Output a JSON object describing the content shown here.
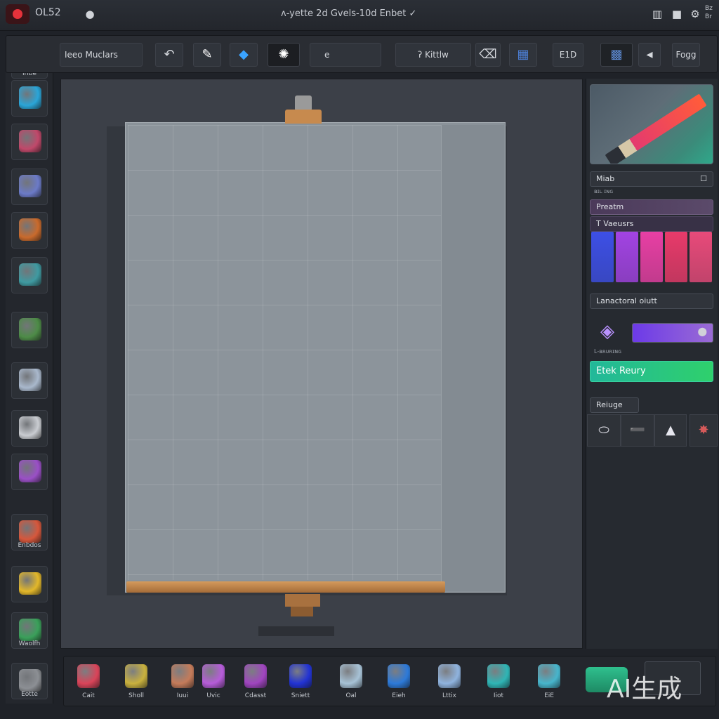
{
  "titlebar": {
    "app_name": "OL52",
    "document_title": "ʌ-yette   2d Gvels-10d Enbet ✓",
    "icons": [
      "record-icon",
      "grid-icon",
      "square-icon",
      "settings-icon"
    ],
    "tray_text": "Bz\nBr"
  },
  "toolbar": {
    "field_label": "Ieeo Muclars",
    "search_label": "e",
    "search2_label": "ʔ   Kittlw",
    "zoom_label": "E1D",
    "right_label": "Fogg",
    "icons": [
      "undo-icon",
      "brush-icon",
      "fill-icon",
      "splatter-icon",
      "eraser-icon",
      "layers-icon",
      "texture-icon",
      "arrow-icon"
    ]
  },
  "leftrail": {
    "items": [
      {
        "label": "Iribe",
        "color": "#2b5fb3",
        "icon": "gem-icon"
      },
      {
        "label": "",
        "color": "#2aa5d8",
        "icon": "bucket-icon"
      },
      {
        "label": "",
        "color": "#c0486a",
        "icon": "marker-icon"
      },
      {
        "label": "",
        "color": "#6b7ac7",
        "icon": "pen-icon"
      },
      {
        "label": "",
        "color": "#c96a2c",
        "icon": "crate-icon"
      },
      {
        "label": "",
        "color": "#3f9aa1",
        "icon": "circuit-icon"
      },
      {
        "label": "",
        "color": "#4d8b47",
        "icon": "mosaic-icon"
      },
      {
        "label": "",
        "color": "#a9b8cc",
        "icon": "chat-icon"
      },
      {
        "label": "",
        "color": "#c9ccd1",
        "icon": "document-icon"
      },
      {
        "label": "",
        "color": "#9a4fc6",
        "icon": "flower-icon"
      },
      {
        "label": "Enbdos",
        "color": "#d6573c",
        "icon": "palette-icon"
      },
      {
        "label": "",
        "color": "#e2b72a",
        "icon": "sphere-icon"
      },
      {
        "label": "Waolfh",
        "color": "#3aa05a",
        "icon": "orb-icon"
      },
      {
        "label": "Eotte",
        "color": "#8c8f94",
        "icon": "brush-set-icon"
      }
    ]
  },
  "rightpanel": {
    "preview_icon": "pencil-icon",
    "rows": {
      "mask": "Miab",
      "mask_sub": "ʙɪʟ ɪɴɢ",
      "preset": "Preatm",
      "variants": "T Vaeusrs",
      "color_mode": "Lanactoral oiutt",
      "gradient_sub": "L-ʙʀᴜʀɪɴɢ",
      "brush_ready": "Etek Reury",
      "reset": "Reiuge"
    },
    "swatches": [
      "#3d4fe6",
      "#a243e3",
      "#e83fa4",
      "#e83a6a",
      "#e84a7a"
    ],
    "gradient_colors": [
      "#6c3ae8",
      "#9a6bd4"
    ],
    "brush_icons": [
      "eraser-icon",
      "stroke-icon",
      "nib-icon",
      "splat-icon"
    ]
  },
  "dock": {
    "items": [
      {
        "label": "Cait",
        "color": "#d94459",
        "icon": "fabric-icon"
      },
      {
        "label": "Sholl",
        "color": "#c9b13e",
        "icon": "shell-icon"
      },
      {
        "label": "Iuui",
        "color": "#c47b5a",
        "icon": "figure-icon"
      },
      {
        "label": "Uvic",
        "color": "#b65cd9",
        "icon": "cube-icon"
      },
      {
        "label": "Cdasst",
        "color": "#a045c0",
        "icon": "box-icon"
      },
      {
        "label": "Sniett",
        "color": "#2233d4",
        "icon": "blob-icon"
      },
      {
        "label": "Oal",
        "color": "#a7c2d6",
        "icon": "house-icon"
      },
      {
        "label": "Eieh",
        "color": "#2d7ad9",
        "icon": "flag-icon"
      },
      {
        "label": "Lttix",
        "color": "#8fb3de",
        "icon": "frame-icon"
      },
      {
        "label": "Iiot",
        "color": "#2fb5b5",
        "icon": "jar-icon"
      },
      {
        "label": "EiE",
        "color": "#47b5cc",
        "icon": "mountain-icon"
      }
    ]
  },
  "watermark": "AI生成"
}
